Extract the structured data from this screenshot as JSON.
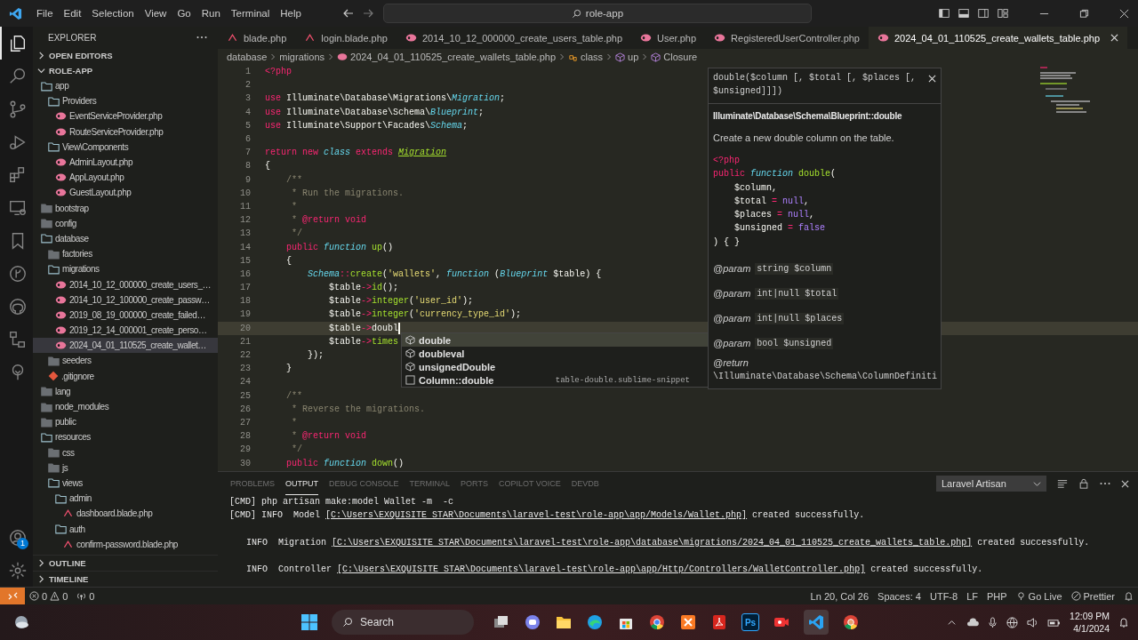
{
  "title_bar": {
    "menu": [
      "File",
      "Edit",
      "Selection",
      "View",
      "Go",
      "Run",
      "Terminal",
      "Help"
    ],
    "search": "role-app"
  },
  "activity_bar": {
    "items": [
      {
        "kind": "files",
        "selected": true
      },
      {
        "kind": "search",
        "selected": false
      },
      {
        "kind": "source-control",
        "selected": false
      },
      {
        "kind": "debug",
        "selected": false
      },
      {
        "kind": "extensions",
        "selected": false
      },
      {
        "kind": "remote",
        "selected": false
      },
      {
        "kind": "bookmark",
        "selected": false
      },
      {
        "kind": "branch-circle",
        "selected": false
      },
      {
        "kind": "round-logo",
        "selected": false
      },
      {
        "kind": "hierarchy",
        "selected": false
      },
      {
        "kind": "tree",
        "selected": false
      }
    ],
    "account_badge": "1"
  },
  "explorer": {
    "title": "EXPLORER",
    "sections": [
      {
        "label": "OPEN EDITORS",
        "expanded": false
      },
      {
        "label": "ROLE-APP",
        "expanded": true
      }
    ],
    "tree": [
      {
        "label": "app",
        "kind": "folder",
        "expanded": true,
        "selected": false,
        "children": [
          {
            "label": "Providers",
            "kind": "folder",
            "expanded": true,
            "selected": false,
            "children": [
              {
                "label": "EventServiceProvider.php",
                "kind": "php",
                "selected": false
              },
              {
                "label": "RouteServiceProvider.php",
                "kind": "php",
                "selected": false
              }
            ]
          },
          {
            "label": "View\\Components",
            "kind": "folder",
            "expanded": true,
            "selected": false,
            "children": [
              {
                "label": "AdminLayout.php",
                "kind": "php",
                "selected": false
              },
              {
                "label": "AppLayout.php",
                "kind": "php",
                "selected": false
              },
              {
                "label": "GuestLayout.php",
                "kind": "php",
                "selected": false
              }
            ]
          }
        ]
      },
      {
        "label": "bootstrap",
        "kind": "folder",
        "expanded": false,
        "selected": false
      },
      {
        "label": "config",
        "kind": "folder",
        "expanded": false,
        "selected": false
      },
      {
        "label": "database",
        "kind": "folder",
        "expanded": true,
        "selected": false,
        "children": [
          {
            "label": "factories",
            "kind": "folder",
            "expanded": false,
            "selected": false
          },
          {
            "label": "migrations",
            "kind": "folder",
            "expanded": true,
            "selected": false,
            "children": [
              {
                "label": "2014_10_12_000000_create_users_…",
                "kind": "php",
                "selected": false
              },
              {
                "label": "2014_10_12_100000_create_passw…",
                "kind": "php",
                "selected": false
              },
              {
                "label": "2019_08_19_000000_create_failed…",
                "kind": "php",
                "selected": false
              },
              {
                "label": "2019_12_14_000001_create_perso…",
                "kind": "php",
                "selected": false
              },
              {
                "label": "2024_04_01_110525_create_wallet…",
                "kind": "php",
                "selected": true
              }
            ]
          },
          {
            "label": "seeders",
            "kind": "folder",
            "expanded": false,
            "selected": false
          },
          {
            "label": ".gitignore",
            "kind": "git",
            "selected": false
          }
        ]
      },
      {
        "label": "lang",
        "kind": "folder",
        "expanded": false,
        "selected": false
      },
      {
        "label": "node_modules",
        "kind": "folder",
        "expanded": false,
        "selected": false
      },
      {
        "label": "public",
        "kind": "folder",
        "expanded": false,
        "selected": false
      },
      {
        "label": "resources",
        "kind": "folder",
        "expanded": true,
        "selected": false,
        "children": [
          {
            "label": "css",
            "kind": "folder",
            "expanded": false,
            "selected": false
          },
          {
            "label": "js",
            "kind": "folder",
            "expanded": false,
            "selected": false
          },
          {
            "label": "views",
            "kind": "folder",
            "expanded": true,
            "selected": false,
            "children": [
              {
                "label": "admin",
                "kind": "folder",
                "expanded": true,
                "selected": false,
                "children": [
                  {
                    "label": "dashboard.blade.php",
                    "kind": "blade",
                    "selected": false
                  }
                ]
              },
              {
                "label": "auth",
                "kind": "folder",
                "expanded": true,
                "selected": false,
                "children": [
                  {
                    "label": "confirm-password.blade.php",
                    "kind": "blade",
                    "selected": false
                  }
                ]
              }
            ]
          }
        ]
      }
    ],
    "bottom_sections": [
      {
        "label": "OUTLINE",
        "expanded": false
      },
      {
        "label": "TIMELINE",
        "expanded": false
      }
    ]
  },
  "tabs": [
    {
      "label": "blade.php",
      "kind": "blade",
      "selected": false
    },
    {
      "label": "login.blade.php",
      "kind": "blade",
      "selected": false
    },
    {
      "label": "2014_10_12_000000_create_users_table.php",
      "kind": "php",
      "selected": false
    },
    {
      "label": "User.php",
      "kind": "php",
      "selected": false
    },
    {
      "label": "RegisteredUserController.php",
      "kind": "php",
      "selected": false
    },
    {
      "label": "2024_04_01_110525_create_wallets_table.php",
      "kind": "php",
      "selected": true
    }
  ],
  "breadcrumbs": [
    {
      "label": "database",
      "kind": "text"
    },
    {
      "label": "migrations",
      "kind": "text"
    },
    {
      "label": "2024_04_01_110525_create_wallets_table.php",
      "kind": "php"
    },
    {
      "label": "class",
      "kind": "class"
    },
    {
      "label": "up",
      "kind": "method"
    },
    {
      "label": "Closure",
      "kind": "method"
    }
  ],
  "editor": {
    "lines": [
      {
        "number": "1",
        "current": false,
        "tokens": [
          {
            "t": "<?php",
            "kind": "tag"
          }
        ]
      },
      {
        "number": "2",
        "current": false
      },
      {
        "number": "3",
        "current": false,
        "tokens": [
          {
            "t": "use",
            "kind": "kw"
          },
          {
            "t": " Illuminate\\Database\\Migrations\\",
            "kind": "tx"
          },
          {
            "t": "Migration",
            "kind": "cls"
          },
          {
            "t": ";",
            "kind": "tx"
          }
        ]
      },
      {
        "number": "4",
        "current": false,
        "tokens": [
          {
            "t": "use",
            "kind": "kw"
          },
          {
            "t": " Illuminate\\Database\\Schema\\",
            "kind": "tx"
          },
          {
            "t": "Blueprint",
            "kind": "cls"
          },
          {
            "t": ";",
            "kind": "tx"
          }
        ]
      },
      {
        "number": "5",
        "current": false,
        "tokens": [
          {
            "t": "use",
            "kind": "kw"
          },
          {
            "t": " Illuminate\\Support\\Facades\\",
            "kind": "tx"
          },
          {
            "t": "Schema",
            "kind": "cls"
          },
          {
            "t": ";",
            "kind": "tx"
          }
        ]
      },
      {
        "number": "6",
        "current": false
      },
      {
        "number": "7",
        "current": false,
        "tokens": [
          {
            "t": "return new ",
            "kind": "kw"
          },
          {
            "t": "class",
            "kind": "st"
          },
          {
            "t": " extends ",
            "kind": "kw"
          },
          {
            "t": "Migration",
            "kind": "ty"
          }
        ]
      },
      {
        "number": "8",
        "current": false,
        "tokens": [
          {
            "t": "{",
            "kind": "tx"
          }
        ]
      },
      {
        "number": "9",
        "current": false,
        "tokens": [
          {
            "t": "    /**",
            "kind": "cm"
          }
        ]
      },
      {
        "number": "10",
        "current": false,
        "tokens": [
          {
            "t": "     * Run the migrations.",
            "kind": "cm"
          }
        ]
      },
      {
        "number": "11",
        "current": false,
        "tokens": [
          {
            "t": "     *",
            "kind": "cm"
          }
        ]
      },
      {
        "number": "12",
        "current": false,
        "tokens": [
          {
            "t": "     * ",
            "kind": "cm"
          },
          {
            "t": "@return void",
            "kind": "kw"
          }
        ]
      },
      {
        "number": "13",
        "current": false,
        "tokens": [
          {
            "t": "     */",
            "kind": "cm"
          }
        ]
      },
      {
        "number": "14",
        "current": false,
        "tokens": [
          {
            "t": "    public ",
            "kind": "kw"
          },
          {
            "t": "function ",
            "kind": "st"
          },
          {
            "t": "up",
            "kind": "fn"
          },
          {
            "t": "()",
            "kind": "tx"
          }
        ]
      },
      {
        "number": "15",
        "current": false,
        "tokens": [
          {
            "t": "    {",
            "kind": "tx"
          }
        ]
      },
      {
        "number": "16",
        "current": false,
        "tokens": [
          {
            "t": "        Schema",
            "kind": "cls"
          },
          {
            "t": "::",
            "kind": "op"
          },
          {
            "t": "create",
            "kind": "fn"
          },
          {
            "t": "(",
            "kind": "tx"
          },
          {
            "t": "'wallets'",
            "kind": "str"
          },
          {
            "t": ", ",
            "kind": "tx"
          },
          {
            "t": "function",
            "kind": "st"
          },
          {
            "t": " (",
            "kind": "tx"
          },
          {
            "t": "Blueprint",
            "kind": "cls"
          },
          {
            "t": " $table) {",
            "kind": "tx"
          }
        ]
      },
      {
        "number": "17",
        "current": false,
        "tokens": [
          {
            "t": "            $table",
            "kind": "tx"
          },
          {
            "t": "->",
            "kind": "op"
          },
          {
            "t": "id",
            "kind": "fn"
          },
          {
            "t": "();",
            "kind": "tx"
          }
        ]
      },
      {
        "number": "18",
        "current": false,
        "tokens": [
          {
            "t": "            $table",
            "kind": "tx"
          },
          {
            "t": "->",
            "kind": "op"
          },
          {
            "t": "integer",
            "kind": "fn"
          },
          {
            "t": "(",
            "kind": "tx"
          },
          {
            "t": "'user_id'",
            "kind": "str"
          },
          {
            "t": ");",
            "kind": "tx"
          }
        ]
      },
      {
        "number": "19",
        "current": false,
        "tokens": [
          {
            "t": "            $table",
            "kind": "tx"
          },
          {
            "t": "->",
            "kind": "op"
          },
          {
            "t": "integer",
            "kind": "fn"
          },
          {
            "t": "(",
            "kind": "tx"
          },
          {
            "t": "'currency_type_id'",
            "kind": "str"
          },
          {
            "t": ");",
            "kind": "tx"
          }
        ]
      },
      {
        "number": "20",
        "current": true,
        "tokens": [
          {
            "t": "            $table",
            "kind": "tx"
          },
          {
            "t": "->",
            "kind": "op"
          },
          {
            "t": "doubl",
            "kind": "tx"
          }
        ]
      },
      {
        "number": "21",
        "current": false,
        "tokens": [
          {
            "t": "            $table",
            "kind": "tx"
          },
          {
            "t": "->",
            "kind": "op"
          },
          {
            "t": "times",
            "kind": "fn"
          }
        ]
      },
      {
        "number": "22",
        "current": false,
        "tokens": [
          {
            "t": "        });",
            "kind": "tx"
          }
        ]
      },
      {
        "number": "23",
        "current": false,
        "tokens": [
          {
            "t": "    }",
            "kind": "tx"
          }
        ]
      },
      {
        "number": "24",
        "current": false
      },
      {
        "number": "25",
        "current": false,
        "tokens": [
          {
            "t": "    /**",
            "kind": "cm"
          }
        ]
      },
      {
        "number": "26",
        "current": false,
        "tokens": [
          {
            "t": "     * Reverse the migrations.",
            "kind": "cm"
          }
        ]
      },
      {
        "number": "27",
        "current": false,
        "tokens": [
          {
            "t": "     *",
            "kind": "cm"
          }
        ]
      },
      {
        "number": "28",
        "current": false,
        "tokens": [
          {
            "t": "     * ",
            "kind": "cm"
          },
          {
            "t": "@return void",
            "kind": "kw"
          }
        ]
      },
      {
        "number": "29",
        "current": false,
        "tokens": [
          {
            "t": "     */",
            "kind": "cm"
          }
        ]
      },
      {
        "number": "30",
        "current": false,
        "tokens": [
          {
            "t": "    public ",
            "kind": "kw"
          },
          {
            "t": "function ",
            "kind": "st"
          },
          {
            "t": "down",
            "kind": "fn"
          },
          {
            "t": "()",
            "kind": "tx"
          }
        ]
      }
    ]
  },
  "suggestions": [
    {
      "label": "double",
      "kind": "method",
      "selected": true
    },
    {
      "label": "doubleval",
      "kind": "method",
      "selected": false
    },
    {
      "label": "unsignedDouble",
      "kind": "method",
      "selected": false
    },
    {
      "label": "Column::double",
      "kind": "snippet",
      "selected": false,
      "detail": "table-double.sublime-snippet"
    }
  ],
  "hover": {
    "signature": "double($column [, $total [, $places [, $unsigned]]])",
    "path": "Illuminate\\Database\\Schema\\Blueprint::double",
    "description": "Create a new double column on the table.",
    "code": [
      [
        {
          "t": "<?php",
          "kind": "tag"
        }
      ],
      [
        {
          "t": "public ",
          "kind": "kw"
        },
        {
          "t": "function ",
          "kind": "st"
        },
        {
          "t": "double",
          "kind": "fn"
        },
        {
          "t": "(",
          "kind": "tx"
        }
      ],
      [
        {
          "t": "    $column,",
          "kind": "tx"
        }
      ],
      [
        {
          "t": "    $total ",
          "kind": "tx"
        },
        {
          "t": "=",
          "kind": "op"
        },
        {
          "t": " null",
          "kind": "const"
        },
        {
          "t": ",",
          "kind": "tx"
        }
      ],
      [
        {
          "t": "    $places ",
          "kind": "tx"
        },
        {
          "t": "=",
          "kind": "op"
        },
        {
          "t": " null",
          "kind": "const"
        },
        {
          "t": ",",
          "kind": "tx"
        }
      ],
      [
        {
          "t": "    $unsigned ",
          "kind": "tx"
        },
        {
          "t": "=",
          "kind": "op"
        },
        {
          "t": " false",
          "kind": "const"
        }
      ],
      [
        {
          "t": ") { }",
          "kind": "tx"
        }
      ]
    ],
    "params": [
      {
        "tag": "@param",
        "value": "string $column"
      },
      {
        "tag": "@param",
        "value": "int|null $total"
      },
      {
        "tag": "@param",
        "value": "int|null $places"
      },
      {
        "tag": "@param",
        "value": "bool $unsigned"
      }
    ],
    "return_tag": "@return",
    "return_value": "\\Illuminate\\Database\\Schema\\ColumnDefiniti"
  },
  "panel": {
    "tabs": [
      {
        "label": "PROBLEMS",
        "selected": false
      },
      {
        "label": "OUTPUT",
        "selected": true
      },
      {
        "label": "DEBUG CONSOLE",
        "selected": false
      },
      {
        "label": "TERMINAL",
        "selected": false
      },
      {
        "label": "PORTS",
        "selected": false
      },
      {
        "label": "COPILOT VOICE",
        "selected": false
      },
      {
        "label": "DEVDB",
        "selected": false
      }
    ],
    "channel": "Laravel Artisan",
    "lines": [
      {
        "kind": "cmd",
        "text": "[CMD] php artisan make:model Wallet -m  -c"
      },
      {
        "kind": "cmd",
        "text": "[CMD] INFO  Model ",
        "link": "[C:\\Users\\EXQUISITE STAR\\Documents\\laravel-test\\role-app\\app/Models/Wallet.php]",
        "after": " created successfully."
      },
      {
        "kind": "info",
        "text": "INFO  Migration ",
        "link": "[C:\\Users\\EXQUISITE STAR\\Documents\\laravel-test\\role-app\\database\\migrations/2024_04_01_110525_create_wallets_table.php]",
        "after": " created successfully."
      },
      {
        "kind": "info",
        "text": "INFO  Controller ",
        "link": "[C:\\Users\\EXQUISITE STAR\\Documents\\laravel-test\\role-app\\app/Http/Controllers/WalletController.php]",
        "after": " created successfully."
      }
    ]
  },
  "status_bar": {
    "errors": "0",
    "warnings": "0",
    "ports": "0",
    "right": [
      "Ln 20, Col 26",
      "Spaces: 4",
      "UTF-8",
      "LF",
      "PHP"
    ],
    "go_live": "Go Live",
    "prettier": "Prettier"
  },
  "taskbar": {
    "search": "Search",
    "photo_app_label": "Ps",
    "time": "12:09 PM",
    "date": "4/1/2024"
  }
}
